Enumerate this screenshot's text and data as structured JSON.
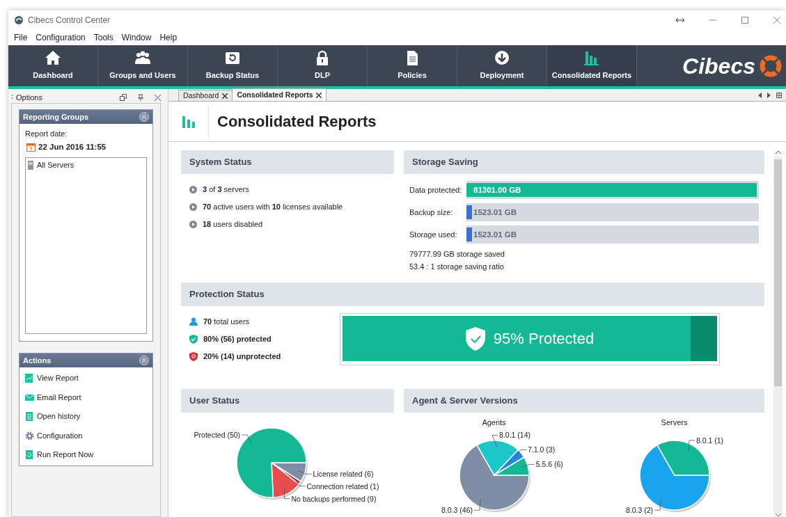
{
  "window": {
    "title": "Cibecs Control Center"
  },
  "menu": [
    "File",
    "Configuration",
    "Tools",
    "Window",
    "Help"
  ],
  "toolbar": {
    "items": [
      {
        "label": "Dashboard",
        "kind": "house",
        "selected": false
      },
      {
        "label": "Groups and Users",
        "kind": "people",
        "selected": false
      },
      {
        "label": "Backup Status",
        "kind": "backup",
        "selected": false
      },
      {
        "label": "DLP",
        "kind": "lock",
        "selected": false
      },
      {
        "label": "Policies",
        "kind": "document",
        "selected": false
      },
      {
        "label": "Deployment",
        "kind": "download",
        "selected": false
      },
      {
        "label": "Consolidated Reports",
        "kind": "bars",
        "selected": true
      }
    ],
    "logo": "Cibecs"
  },
  "options_panel": {
    "title": "Options",
    "reporting_groups": {
      "title": "Reporting Groups",
      "report_date_label": "Report date:",
      "report_date": "22 Jun 2016 11:55",
      "servers": [
        "All Servers"
      ]
    },
    "actions": {
      "title": "Actions",
      "items": [
        {
          "label": "View Report",
          "kind": "chart"
        },
        {
          "label": "Email Report",
          "kind": "email"
        },
        {
          "label": "Open history",
          "kind": "history"
        },
        {
          "label": "Configuration",
          "kind": "gear"
        },
        {
          "label": "Run Report Now",
          "kind": "refresh"
        }
      ]
    }
  },
  "tabs": [
    {
      "label": "Dashboard",
      "selected": false
    },
    {
      "label": "Consolidated Reports",
      "selected": true
    }
  ],
  "page_title": "Consolidated Reports",
  "system_status": {
    "title": "System Status",
    "lines": [
      "**3** of **3** servers",
      "**70** active users with **10** licenses available",
      "**18** users disabled"
    ]
  },
  "storage_saving": {
    "title": "Storage Saving",
    "bars": [
      {
        "label": "Data protected:",
        "value": "81301.00 GB",
        "level": 1,
        "color": "#14b894"
      },
      {
        "label": "Backup size:",
        "value": "1523.01 GB",
        "level": 0.02,
        "color": "#3f6fcf"
      },
      {
        "label": "Storage used:",
        "value": "1523.01 GB",
        "level": 0.02,
        "color": "#3f6fcf"
      }
    ],
    "notes": [
      "79777.99 GB storage saved",
      "53.4 : 1 storage saving ratio"
    ]
  },
  "protection_status": {
    "title": "Protection Status",
    "lines": [
      {
        "kind": "users",
        "text": "**70** total users"
      },
      {
        "kind": "protected",
        "text": "**80% (56) protected**"
      },
      {
        "kind": "unprotected",
        "text": "**20% (14) unprotected**"
      }
    ],
    "meter": {
      "label": "95% Protected",
      "level": 0.93
    }
  },
  "user_status": {
    "title": "User Status",
    "chart_data": {
      "type": "pie",
      "categories": [
        "License related (6)",
        "Connection related (1)",
        "No backups performed (9)",
        "Protected (50)"
      ],
      "values": [
        6,
        1,
        9,
        50
      ],
      "colors": [
        "#7f8ea6",
        "#b8242a",
        "#e84c4c",
        "#14b894"
      ]
    }
  },
  "agent_server_versions": {
    "title": "Agent & Server Versions",
    "charts": [
      {
        "chart_data": {
          "type": "pie",
          "title": "Agents",
          "categories": [
            "8.0.3 (46)",
            "8.0.1 (14)",
            "7.1.0 (3)",
            "5.5.6 (6)"
          ],
          "values": [
            46,
            14,
            3,
            6
          ],
          "colors": [
            "#7f8ea6",
            "#1cc6c9",
            "#1e88e5",
            "#14b894"
          ]
        }
      },
      {
        "chart_data": {
          "type": "pie",
          "title": "Servers",
          "categories": [
            "8.0.3 (2)",
            "8.0.1 (1)"
          ],
          "values": [
            2,
            1
          ],
          "colors": [
            "#1aa3ef",
            "#14b894"
          ]
        }
      }
    ]
  }
}
